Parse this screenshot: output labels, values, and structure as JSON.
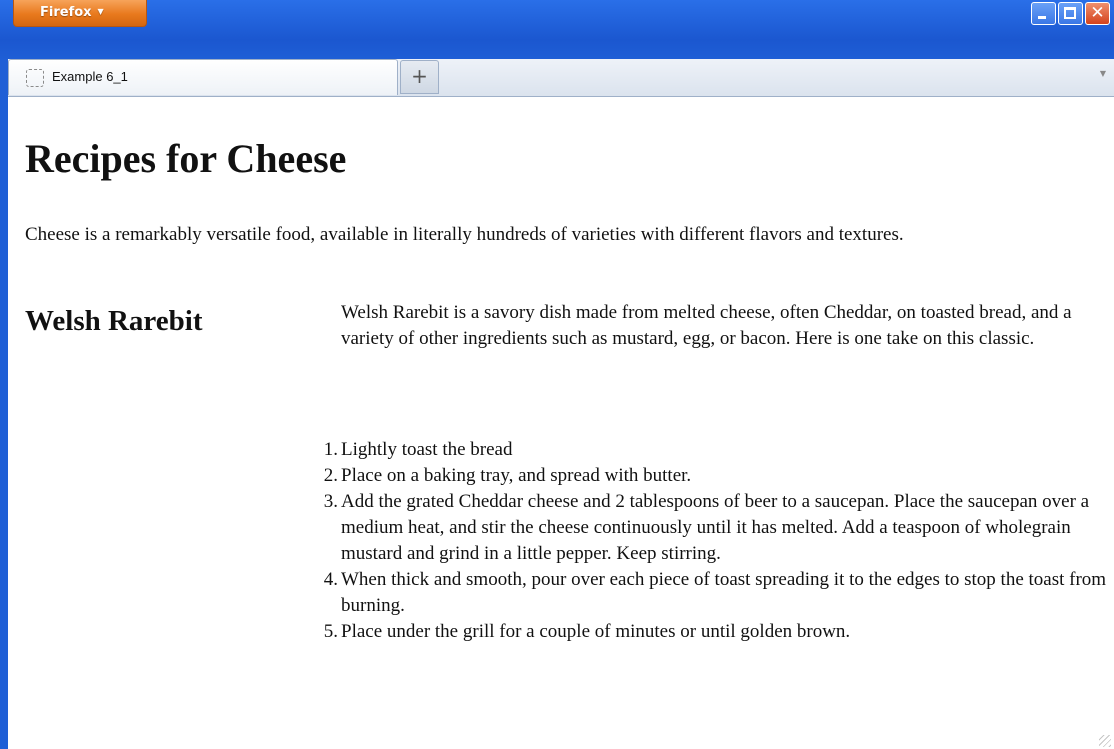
{
  "window": {
    "app_button_label": "Firefox",
    "controls": {
      "minimize": "minimize",
      "maximize": "maximize",
      "close": "close"
    }
  },
  "tabs": [
    {
      "title": "Example 6_1",
      "icon": "page-icon"
    }
  ],
  "new_tab_label": "+",
  "page": {
    "title": "Recipes for Cheese",
    "intro": "Cheese is a remarkably versatile food, available in literally hundreds of varieties with different flavors and textures.",
    "recipe": {
      "heading": "Welsh Rarebit",
      "description": "Welsh Rarebit is a savory dish made from melted cheese, often Cheddar, on toasted bread, and a variety of other ingredients such as mustard, egg, or bacon. Here is one take on this classic.",
      "steps": [
        {
          "num": "1.",
          "text": "Lightly toast the bread"
        },
        {
          "num": "2.",
          "text": "Place on a baking tray, and spread with butter."
        },
        {
          "num": "3.",
          "text": "Add the grated Cheddar cheese and 2 tablespoons of beer to a saucepan. Place the saucepan over a medium heat, and stir the cheese continuously until it has melted. Add a teaspoon of wholegrain mustard and grind in a little pepper. Keep stirring."
        },
        {
          "num": "4.",
          "text": "When thick and smooth, pour over each piece of toast spreading it to the edges to stop the toast from burning."
        },
        {
          "num": "5.",
          "text": "Place under the grill for a couple of minutes or until golden brown."
        }
      ]
    }
  },
  "colors": {
    "titlebar": "#1f5fd6",
    "firefox_button": "#e8791d",
    "close_button": "#d4431c"
  }
}
